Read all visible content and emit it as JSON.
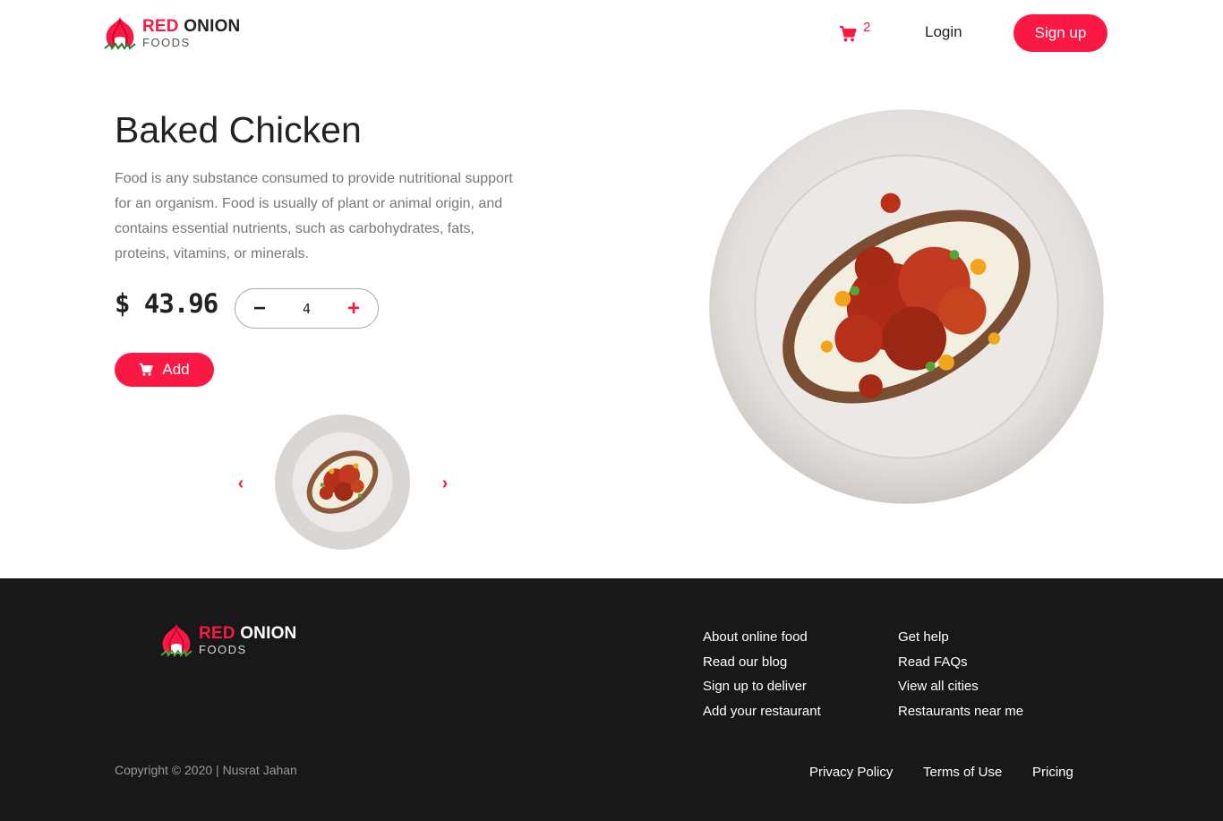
{
  "brand": {
    "name_red": "RED",
    "name_dark": "ONION",
    "sub": "FOODS"
  },
  "header": {
    "cart_count": "2",
    "login_label": "Login",
    "signup_label": "Sign up"
  },
  "product": {
    "title": "Baked Chicken",
    "description": "Food is any substance consumed to provide nutritional support for an organism. Food is usually of plant or animal origin, and contains essential nutrients, such as carbohydrates, fats, proteins, vitamins, or minerals.",
    "price": "$ 43.96",
    "quantity": "4",
    "minus_label": "−",
    "plus_label": "+",
    "add_label": "Add"
  },
  "carousel": {
    "prev": "‹",
    "next": "›"
  },
  "footer": {
    "col1": [
      "About online food",
      "Read our blog",
      "Sign up to deliver",
      "Add your restaurant"
    ],
    "col2": [
      "Get help",
      "Read FAQs",
      "View all cities",
      "Restaurants near me"
    ],
    "copyright": "Copyright © 2020 | Nusrat Jahan",
    "privacy": "Privacy Policy",
    "terms": "Terms of Use",
    "pricing": "Pricing"
  },
  "icons": {
    "cart": "cart-icon",
    "logo": "onion-logo-icon",
    "prev": "chevron-left-icon",
    "next": "chevron-right-icon"
  },
  "colors": {
    "accent": "#f91944",
    "footer_bg": "#181818",
    "text_muted": "#777777"
  }
}
